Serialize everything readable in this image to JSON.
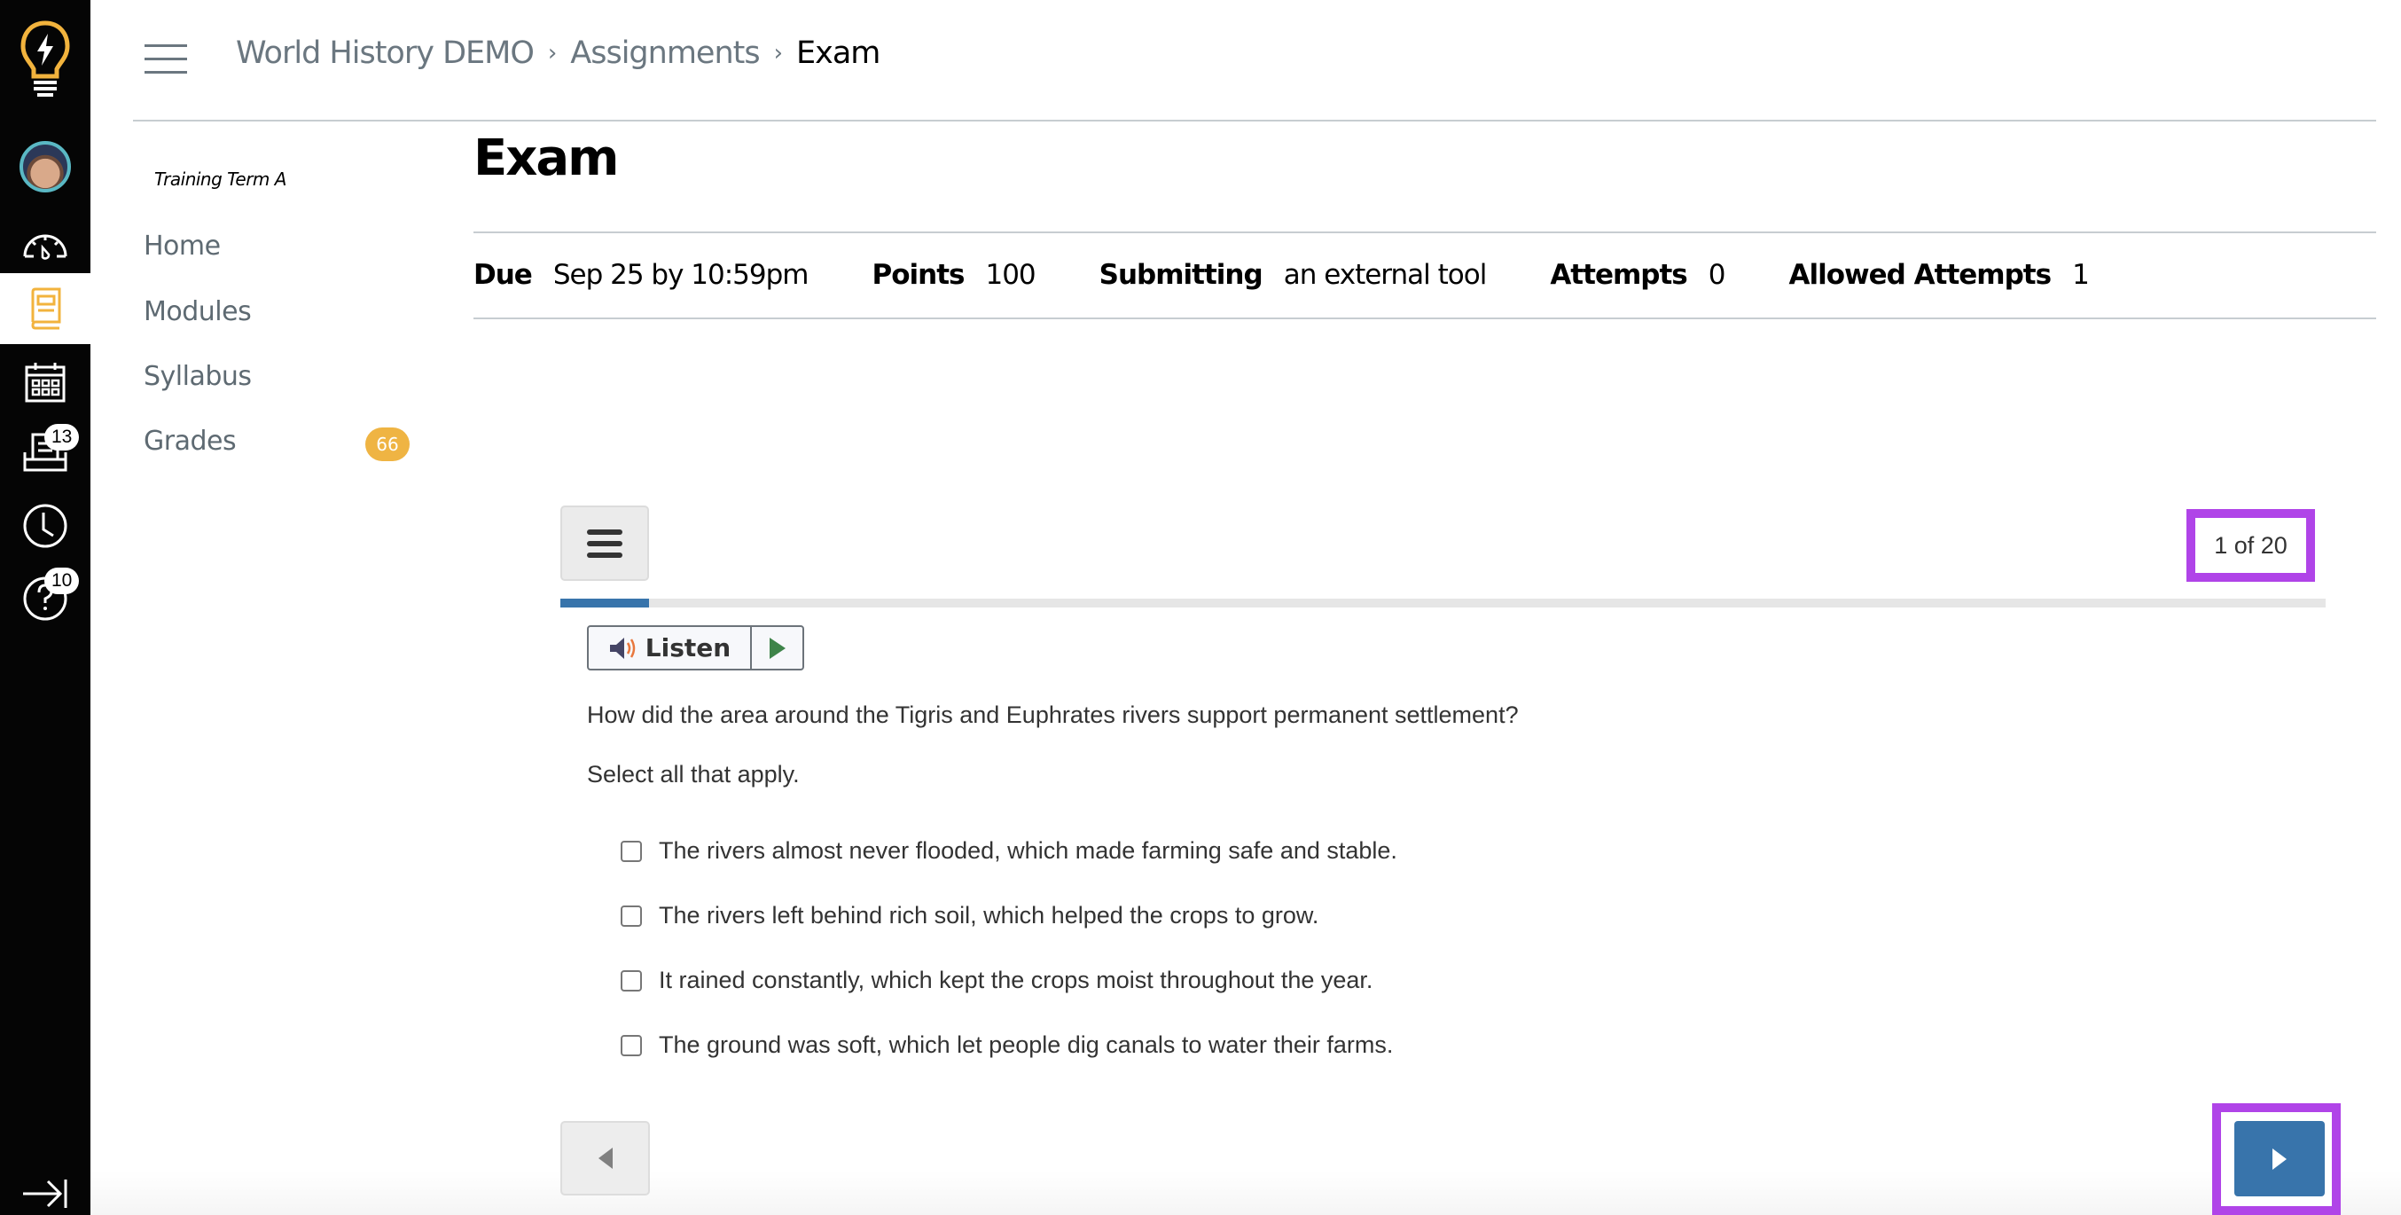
{
  "global_nav": {
    "items": [
      {
        "name": "logo",
        "icon": "lightbulb-icon"
      },
      {
        "name": "account",
        "icon": "avatar"
      },
      {
        "name": "dashboard",
        "icon": "dashboard-gauge-icon"
      },
      {
        "name": "courses",
        "icon": "book-icon",
        "active": true
      },
      {
        "name": "calendar",
        "icon": "calendar-icon"
      },
      {
        "name": "inbox",
        "icon": "inbox-icon",
        "badge": "13"
      },
      {
        "name": "history",
        "icon": "clock-icon"
      },
      {
        "name": "help",
        "icon": "help-icon",
        "badge": "10"
      },
      {
        "name": "collapse",
        "icon": "collapse-arrow-icon"
      }
    ],
    "inbox_badge": "13",
    "help_badge": "10"
  },
  "header": {
    "breadcrumb": [
      "World History DEMO",
      "Assignments",
      "Exam"
    ],
    "separator": "›"
  },
  "course_nav": {
    "term": "Training Term A",
    "items": [
      {
        "label": "Home"
      },
      {
        "label": "Modules"
      },
      {
        "label": "Syllabus"
      },
      {
        "label": "Grades",
        "badge": "66"
      }
    ]
  },
  "assignment": {
    "title": "Exam",
    "meta": [
      {
        "label": "Due",
        "value": "Sep 25 by 10:59pm"
      },
      {
        "label": "Points",
        "value": "100"
      },
      {
        "label": "Submitting",
        "value": "an external tool"
      },
      {
        "label": "Attempts",
        "value": "0"
      },
      {
        "label": "Allowed Attempts",
        "value": "1"
      }
    ]
  },
  "quiz": {
    "counter": "1 of 20",
    "progress_fraction": 0.05,
    "listen_label": "Listen",
    "question": "How did the area around the Tigris and Euphrates rivers support permanent settlement?",
    "instruction": "Select all that apply.",
    "options": [
      {
        "text": "The rivers almost never flooded, which made farming safe and stable.",
        "checked": false
      },
      {
        "text": "The rivers left behind rich soil, which helped the crops to grow.",
        "checked": false
      },
      {
        "text": "It rained constantly, which kept the crops moist throughout the year.",
        "checked": false
      },
      {
        "text": "The ground was soft, which let people dig canals to water their farms.",
        "checked": false
      }
    ]
  },
  "colors": {
    "accent_blue": "#3874ab",
    "highlight_purple": "#b044e8",
    "badge_orange": "#efb443",
    "brand_yellow": "#f2b33d",
    "avatar_ring": "#5ab8c4"
  }
}
